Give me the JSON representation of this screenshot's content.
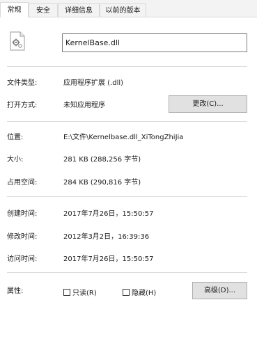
{
  "tabs": [
    {
      "label": "常规"
    },
    {
      "label": "安全"
    },
    {
      "label": "详细信息"
    },
    {
      "label": "以前的版本"
    }
  ],
  "file": {
    "name": "KernelBase.dll",
    "icon": "dll-file-icon"
  },
  "type": {
    "label": "文件类型:",
    "value": "应用程序扩展 (.dll)"
  },
  "opens_with": {
    "label": "打开方式:",
    "value": "未知应用程序",
    "button": "更改(C)..."
  },
  "location": {
    "label": "位置:",
    "value": "E:\\文件\\Kernelbase.dll_XiTongZhiJia"
  },
  "size": {
    "label": "大小:",
    "value": "281 KB (288,256 字节)"
  },
  "size_on_disk": {
    "label": "占用空间:",
    "value": "284 KB (290,816 字节)"
  },
  "created": {
    "label": "创建时间:",
    "value": "2017年7月26日，15:50:57"
  },
  "modified": {
    "label": "修改时间:",
    "value": "2012年3月2日，16:39:36"
  },
  "accessed": {
    "label": "访问时间:",
    "value": "2017年7月26日，15:50:57"
  },
  "attributes": {
    "label": "属性:",
    "readonly": "只读(R)",
    "hidden": "隐藏(H)",
    "advanced": "高级(D)..."
  }
}
